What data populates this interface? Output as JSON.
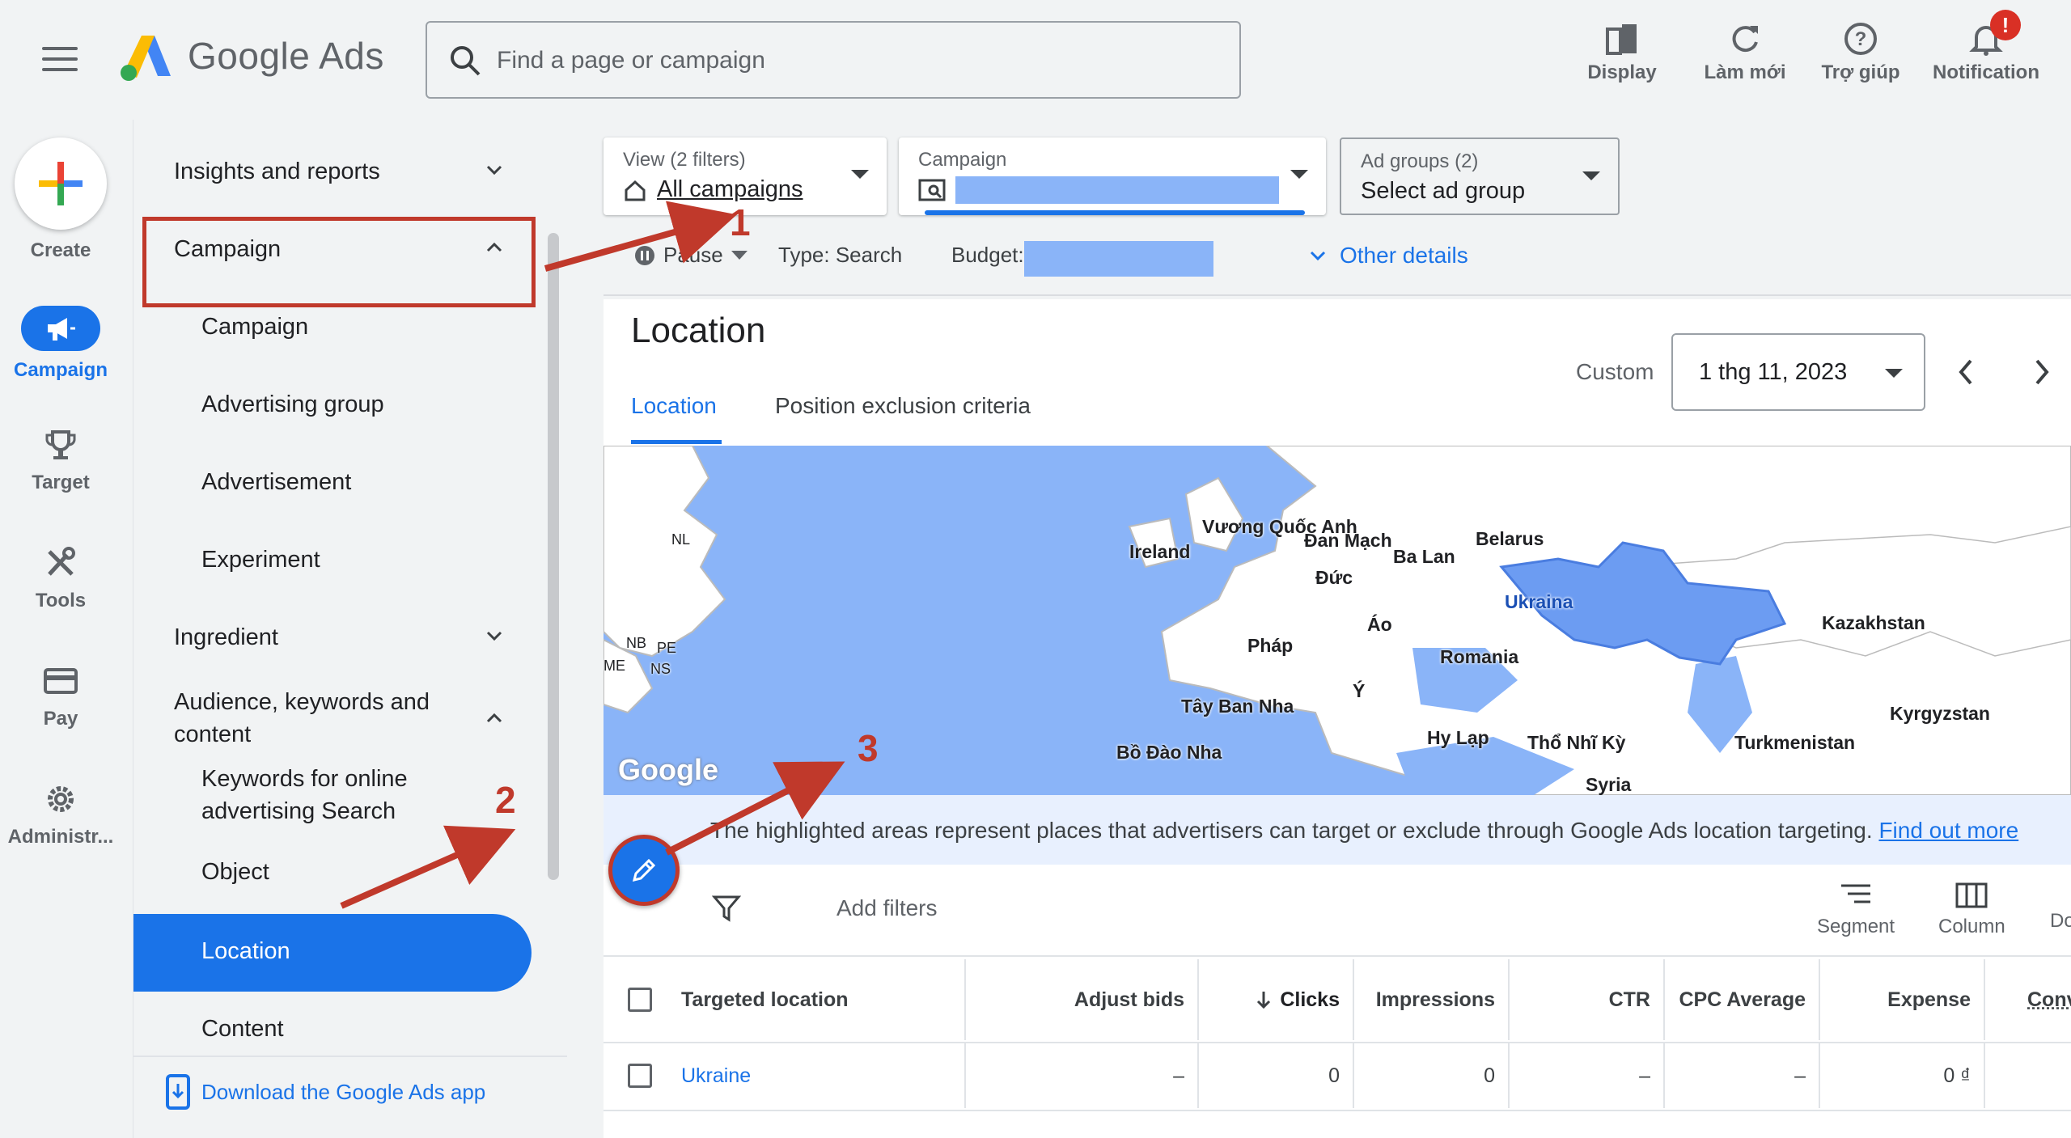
{
  "header": {
    "brand": "Google Ads",
    "search_placeholder": "Find a page or campaign",
    "actions": [
      {
        "label": "Display",
        "icon": "display-icon"
      },
      {
        "label": "Làm mới",
        "icon": "refresh-icon"
      },
      {
        "label": "Trợ giúp",
        "icon": "help-icon"
      },
      {
        "label": "Notification",
        "icon": "bell-icon"
      }
    ],
    "notification_badge": "!"
  },
  "rail": {
    "create": "Create",
    "items": [
      {
        "label": "Campaign",
        "icon": "megaphone-icon",
        "active": true
      },
      {
        "label": "Target",
        "icon": "trophy-icon"
      },
      {
        "label": "Tools",
        "icon": "tools-icon"
      },
      {
        "label": "Pay",
        "icon": "credit-card-icon"
      },
      {
        "label": "Administr...",
        "icon": "gear-icon"
      }
    ]
  },
  "nav": {
    "items": [
      {
        "label": "Insights and reports",
        "level": "top",
        "chevron": "down"
      },
      {
        "label": "Campaign",
        "level": "top",
        "chevron": "up"
      },
      {
        "label": "Campaign",
        "level": "sub"
      },
      {
        "label": "Advertising group",
        "level": "sub"
      },
      {
        "label": "Advertisement",
        "level": "sub"
      },
      {
        "label": "Experiment",
        "level": "sub"
      },
      {
        "label": "Ingredient",
        "level": "top",
        "chevron": "down"
      },
      {
        "label": "Audience, keywords and content",
        "level": "top",
        "chevron": "up"
      },
      {
        "label": "Keywords for online advertising Search",
        "level": "sub"
      },
      {
        "label": "Object",
        "level": "sub"
      },
      {
        "label": "Location",
        "level": "sub",
        "active": true
      },
      {
        "label": "Content",
        "level": "sub"
      }
    ],
    "download": "Download the Google Ads app"
  },
  "filters": {
    "view_label": "View (2 filters)",
    "view_value": "All campaigns",
    "campaign_label": "Campaign",
    "adgroup_label": "Ad groups (2)",
    "adgroup_value": "Select ad group"
  },
  "subrow": {
    "status": "Pause",
    "type": "Type: Search",
    "budget": "Budget:",
    "other": "Other details"
  },
  "page": {
    "title": "Location",
    "tabs": [
      "Location",
      "Position exclusion criteria"
    ],
    "active_tab": 0,
    "date_label": "Custom",
    "date_value": "1 thg 11, 2023"
  },
  "map": {
    "labels": [
      "Đan Mạch",
      "Vương Quốc Anh",
      "Ireland",
      "Belarus",
      "Ba Lan",
      "Đức",
      "Ukraina",
      "Kazakhstan",
      "Pháp",
      "Áo",
      "Romania",
      "Ý",
      "Tây Ban Nha",
      "Bồ Đào Nha",
      "Hy Lạp",
      "Thổ Nhĩ Kỳ",
      "Turkmenistan",
      "Kyrgyzstan",
      "Syria",
      "NL",
      "NB",
      "PE",
      "NS",
      "ME"
    ],
    "watermark": "Google"
  },
  "info": {
    "text": "The highlighted areas represent places that advertisers can target or exclude through Google Ads location targeting.",
    "link": "Find out more"
  },
  "toolbar": {
    "add_filters": "Add filters",
    "segment": "Segment",
    "column": "Column",
    "cut": "Do"
  },
  "table": {
    "headers": [
      "Targeted location",
      "Adjust bids",
      "Clicks",
      "Impressions",
      "CTR",
      "CPC Average",
      "Expense",
      "Conv"
    ],
    "rows": [
      [
        "Ukraine",
        "–",
        "0",
        "0",
        "–",
        "–",
        "0 ₫",
        ""
      ]
    ]
  },
  "annotations": [
    "1",
    "2",
    "3"
  ],
  "colors": {
    "accent": "#1a73e8",
    "annotation": "#c0392b",
    "map_water": "#8ab4f8"
  }
}
